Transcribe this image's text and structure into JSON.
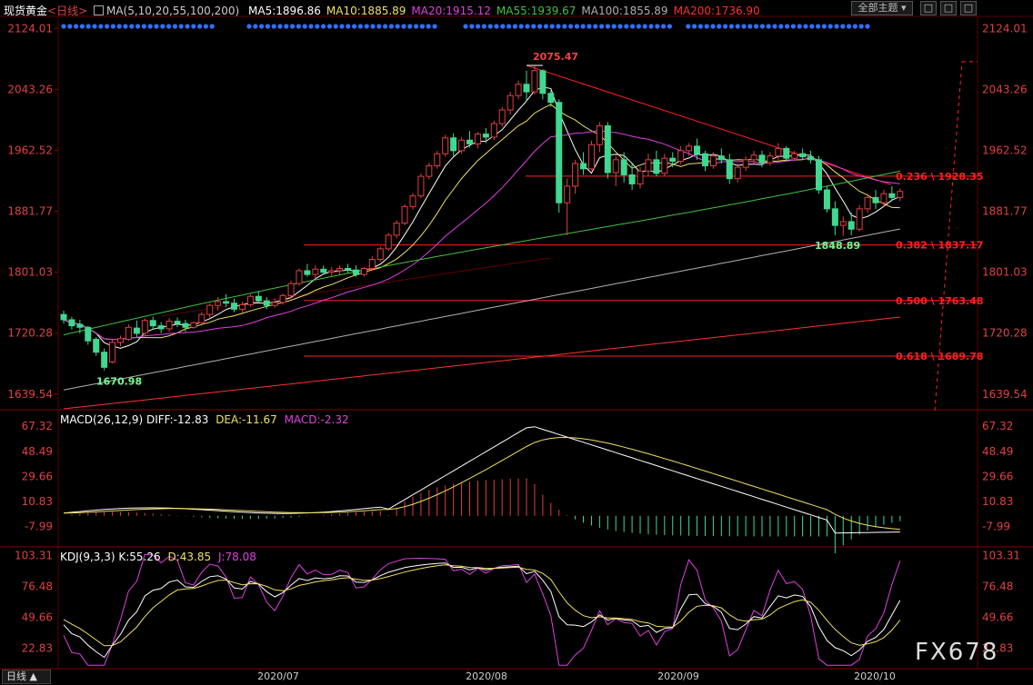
{
  "header": {
    "title": "现货黄金",
    "period": "<日线>",
    "ma_label": "MA(5,10,20,55,100,200)",
    "ma_values": [
      {
        "text": "MA5:1896.86",
        "color": "#ffffff"
      },
      {
        "text": "MA10:1885.89",
        "color": "#f0e060"
      },
      {
        "text": "MA20:1915.12",
        "color": "#e040e0"
      },
      {
        "text": "MA55:1939.67",
        "color": "#40c040"
      },
      {
        "text": "MA100:1855.89",
        "color": "#b0b0b0"
      },
      {
        "text": "MA200:1736.90",
        "color": "#ff3030"
      }
    ],
    "theme_button": "全部主题",
    "window_buttons": [
      "□",
      "□",
      "□"
    ]
  },
  "price_axis": [
    "2124.01",
    "2043.26",
    "1962.52",
    "1881.77",
    "1801.03",
    "1720.28",
    "1639.54"
  ],
  "annotations": {
    "high": "2075.47",
    "low": "1670.98",
    "recent_low": "1848.89",
    "fib": [
      "0.236 \\ 1928.35",
      "0.382 \\ 1837.17",
      "0.500 \\ 1763.48",
      "0.618 \\ 1689.78"
    ]
  },
  "macd": {
    "label": "MACD(26,12,9)",
    "diff": "DIFF:-12.83",
    "dea": "DEA:-11.67",
    "macd": "MACD:-2.32",
    "axis": [
      "67.32",
      "48.49",
      "29.66",
      "10.83",
      "-7.99"
    ]
  },
  "kdj": {
    "label": "KDJ(9,3,3)",
    "k": "K:55.26",
    "d": "D:43.85",
    "j": "J:78.08",
    "axis": [
      "103.31",
      "76.48",
      "49.66",
      "22.83"
    ]
  },
  "date_axis": [
    "2020/07",
    "2020/08",
    "2020/09",
    "2020/10"
  ],
  "footer": {
    "period_button": "日线 ▲"
  },
  "watermark": "FX678",
  "colors": {
    "up": "#e04040",
    "down": "#40d890",
    "fib": "#ff2020",
    "grid": "#4a0000"
  },
  "chart_data": {
    "type": "candlestick",
    "price_range": [
      1620,
      2140
    ],
    "candles": [
      [
        1745,
        1750,
        1733,
        1738
      ],
      [
        1738,
        1742,
        1725,
        1730
      ],
      [
        1732,
        1738,
        1720,
        1728
      ],
      [
        1728,
        1730,
        1705,
        1710
      ],
      [
        1712,
        1715,
        1690,
        1695
      ],
      [
        1695,
        1700,
        1671,
        1675
      ],
      [
        1682,
        1712,
        1680,
        1708
      ],
      [
        1708,
        1717,
        1703,
        1713
      ],
      [
        1712,
        1732,
        1710,
        1728
      ],
      [
        1727,
        1737,
        1715,
        1720
      ],
      [
        1720,
        1740,
        1716,
        1737
      ],
      [
        1737,
        1742,
        1725,
        1730
      ],
      [
        1730,
        1735,
        1720,
        1726
      ],
      [
        1726,
        1740,
        1722,
        1736
      ],
      [
        1736,
        1741,
        1728,
        1733
      ],
      [
        1733,
        1738,
        1722,
        1728
      ],
      [
        1728,
        1736,
        1726,
        1734
      ],
      [
        1734,
        1748,
        1730,
        1745
      ],
      [
        1745,
        1760,
        1740,
        1757
      ],
      [
        1757,
        1768,
        1750,
        1762
      ],
      [
        1762,
        1772,
        1755,
        1760
      ],
      [
        1760,
        1766,
        1748,
        1752
      ],
      [
        1752,
        1762,
        1748,
        1758
      ],
      [
        1758,
        1772,
        1755,
        1769
      ],
      [
        1769,
        1776,
        1760,
        1763
      ],
      [
        1763,
        1768,
        1752,
        1757
      ],
      [
        1757,
        1766,
        1754,
        1761
      ],
      [
        1761,
        1773,
        1758,
        1770
      ],
      [
        1770,
        1790,
        1766,
        1786
      ],
      [
        1786,
        1806,
        1783,
        1803
      ],
      [
        1803,
        1812,
        1795,
        1798
      ],
      [
        1798,
        1810,
        1792,
        1805
      ],
      [
        1805,
        1810,
        1798,
        1801
      ],
      [
        1801,
        1808,
        1796,
        1803
      ],
      [
        1803,
        1810,
        1798,
        1806
      ],
      [
        1806,
        1812,
        1800,
        1804
      ],
      [
        1804,
        1810,
        1795,
        1798
      ],
      [
        1798,
        1808,
        1795,
        1806
      ],
      [
        1806,
        1822,
        1803,
        1818
      ],
      [
        1818,
        1835,
        1815,
        1832
      ],
      [
        1832,
        1853,
        1829,
        1850
      ],
      [
        1850,
        1870,
        1846,
        1866
      ],
      [
        1866,
        1891,
        1863,
        1888
      ],
      [
        1888,
        1906,
        1884,
        1902
      ],
      [
        1902,
        1932,
        1899,
        1928
      ],
      [
        1928,
        1946,
        1924,
        1942
      ],
      [
        1942,
        1962,
        1938,
        1958
      ],
      [
        1958,
        1983,
        1954,
        1979
      ],
      [
        1979,
        1985,
        1955,
        1962
      ],
      [
        1962,
        1980,
        1958,
        1976
      ],
      [
        1976,
        1988,
        1966,
        1971
      ],
      [
        1971,
        1987,
        1965,
        1984
      ],
      [
        1984,
        1992,
        1972,
        1980
      ],
      [
        1980,
        2002,
        1976,
        1998
      ],
      [
        1998,
        2020,
        1994,
        2016
      ],
      [
        2016,
        2040,
        2010,
        2035
      ],
      [
        2035,
        2055,
        2030,
        2050
      ],
      [
        2050,
        2068,
        2028,
        2040
      ],
      [
        2040,
        2075,
        2036,
        2068
      ],
      [
        2068,
        2070,
        2030,
        2038
      ],
      [
        2038,
        2042,
        2020,
        2026
      ],
      [
        2026,
        2030,
        1880,
        1893
      ],
      [
        1893,
        1925,
        1850,
        1915
      ],
      [
        1915,
        1950,
        1905,
        1945
      ],
      [
        1945,
        1960,
        1930,
        1938
      ],
      [
        1938,
        1975,
        1936,
        1970
      ],
      [
        1970,
        2000,
        1960,
        1995
      ],
      [
        1995,
        2000,
        1925,
        1933
      ],
      [
        1933,
        1955,
        1915,
        1950
      ],
      [
        1950,
        1960,
        1920,
        1930
      ],
      [
        1930,
        1945,
        1910,
        1918
      ],
      [
        1918,
        1940,
        1912,
        1935
      ],
      [
        1935,
        1958,
        1928,
        1950
      ],
      [
        1950,
        1962,
        1928,
        1932
      ],
      [
        1932,
        1958,
        1928,
        1952
      ],
      [
        1952,
        1960,
        1940,
        1948
      ],
      [
        1948,
        1968,
        1944,
        1962
      ],
      [
        1962,
        1972,
        1955,
        1968
      ],
      [
        1968,
        1978,
        1950,
        1958
      ],
      [
        1958,
        1962,
        1935,
        1942
      ],
      [
        1942,
        1960,
        1938,
        1955
      ],
      [
        1955,
        1965,
        1945,
        1950
      ],
      [
        1950,
        1958,
        1918,
        1925
      ],
      [
        1925,
        1945,
        1920,
        1940
      ],
      [
        1940,
        1955,
        1935,
        1950
      ],
      [
        1950,
        1962,
        1944,
        1956
      ],
      [
        1956,
        1962,
        1940,
        1946
      ],
      [
        1946,
        1960,
        1942,
        1955
      ],
      [
        1955,
        1972,
        1950,
        1965
      ],
      [
        1965,
        1968,
        1948,
        1952
      ],
      [
        1952,
        1962,
        1948,
        1958
      ],
      [
        1958,
        1965,
        1950,
        1954
      ],
      [
        1954,
        1962,
        1945,
        1950
      ],
      [
        1950,
        1955,
        1905,
        1910
      ],
      [
        1910,
        1915,
        1880,
        1885
      ],
      [
        1885,
        1895,
        1850,
        1863
      ],
      [
        1863,
        1875,
        1849,
        1868
      ],
      [
        1868,
        1880,
        1850,
        1858
      ],
      [
        1858,
        1890,
        1855,
        1885
      ],
      [
        1885,
        1905,
        1880,
        1900
      ],
      [
        1900,
        1910,
        1885,
        1893
      ],
      [
        1893,
        1910,
        1888,
        1905
      ],
      [
        1905,
        1915,
        1895,
        1900
      ],
      [
        1900,
        1912,
        1895,
        1908
      ]
    ],
    "fib_levels": [
      {
        "ratio": "0.236",
        "price": 1928.35
      },
      {
        "ratio": "0.382",
        "price": 1837.17
      },
      {
        "ratio": "0.500",
        "price": 1763.48
      },
      {
        "ratio": "0.618",
        "price": 1689.78
      }
    ],
    "macd_range": [
      -20,
      75
    ],
    "kdj_range": [
      5,
      110
    ]
  }
}
